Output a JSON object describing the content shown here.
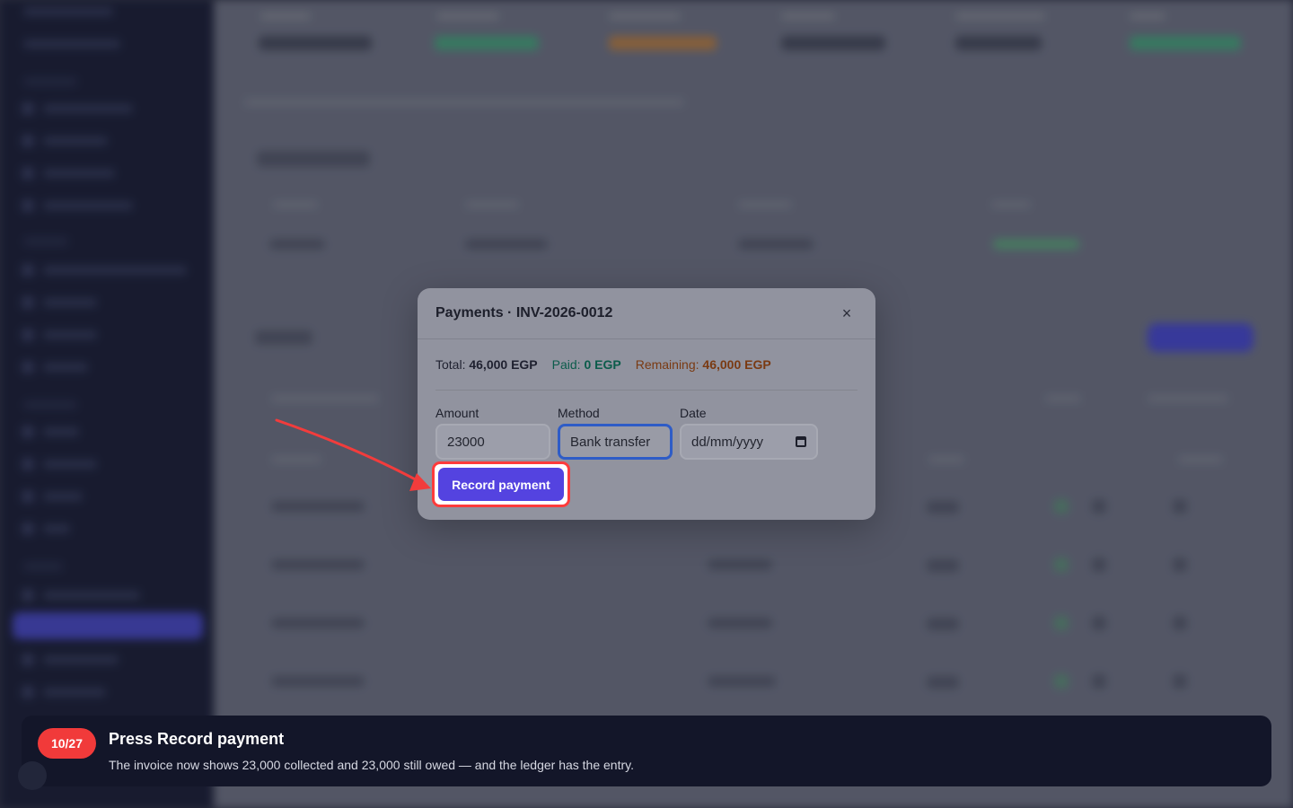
{
  "modal": {
    "title": "Payments · INV-2026-0012",
    "close_icon": "×",
    "summary": {
      "total_label": "Total:",
      "total_value": "46,000 EGP",
      "paid_label": "Paid:",
      "paid_value": "0 EGP",
      "remaining_label": "Remaining:",
      "remaining_value": "46,000 EGP"
    },
    "fields": {
      "amount_label": "Amount",
      "amount_value": "23000",
      "method_label": "Method",
      "method_value": "Bank transfer",
      "date_label": "Date",
      "date_placeholder": "dd/mm/yyyy"
    },
    "record_label": "Record payment"
  },
  "toast": {
    "step": "10/27",
    "title": "Press Record payment",
    "description": "The invoice now shows 23,000 collected and 23,000 still owed — and the ledger has the entry."
  },
  "colors": {
    "accent": "#5443e0",
    "highlight": "#ff3b3b",
    "paid": "#0c5c4b",
    "remaining": "#7a3a12"
  }
}
